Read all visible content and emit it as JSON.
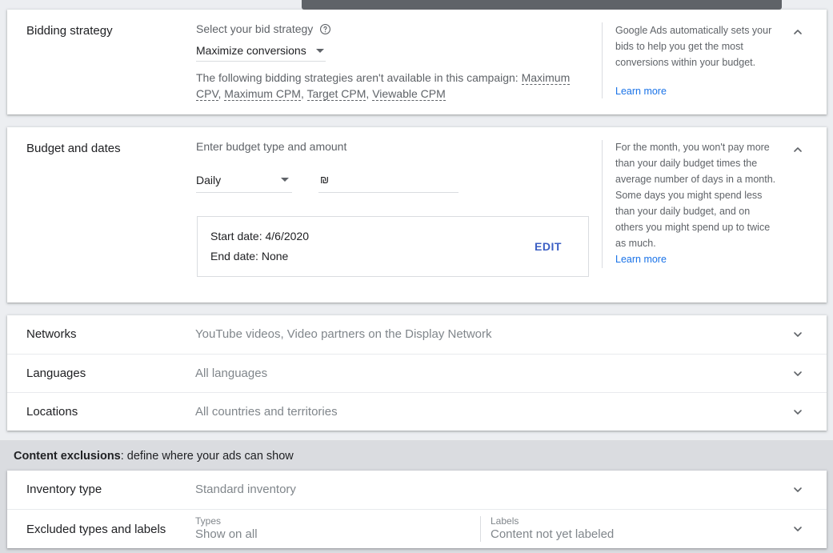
{
  "bidding": {
    "title": "Bidding strategy",
    "select_label": "Select your bid strategy",
    "selected": "Maximize conversions",
    "unavailable_prefix": "The following bidding strategies aren't available in this campaign: ",
    "unavailable": [
      "Maximum CPV",
      "Maximum CPM",
      "Target CPM",
      "Viewable CPM"
    ],
    "help": "Google Ads automatically sets your bids to help you get the most conversions within your budget.",
    "learn_more": "Learn more"
  },
  "budget": {
    "title": "Budget and dates",
    "label": "Enter budget type and amount",
    "type": "Daily",
    "currency_symbol": "₪",
    "start_date": "Start date: 4/6/2020",
    "end_date": "End date: None",
    "edit": "EDIT",
    "help": "For the month, you won't pay more than your daily budget times the average number of days in a month. Some days you might spend less than your daily budget, and on others you might spend up to twice as much.",
    "learn_more": "Learn more"
  },
  "settings_rows": [
    {
      "label": "Networks",
      "value": "YouTube videos, Video partners on the Display Network"
    },
    {
      "label": "Languages",
      "value": "All languages"
    },
    {
      "label": "Locations",
      "value": "All countries and territories"
    }
  ],
  "content_exclusions": {
    "heading_bold": "Content exclusions",
    "heading_rest": ": define where your ads can show",
    "inventory": {
      "label": "Inventory type",
      "value": "Standard inventory"
    },
    "excluded": {
      "label": "Excluded types and labels",
      "types_caption": "Types",
      "types_value": "Show on all",
      "labels_caption": "Labels",
      "labels_value": "Content not yet labeled"
    }
  },
  "icons": {
    "help": "help-circle-icon",
    "expand": "chevron-down-icon",
    "collapse": "chevron-up-icon",
    "dropdown": "caret-down-icon"
  },
  "colors": {
    "link": "#1a73e8",
    "edit": "#3c5fc4",
    "muted": "#5f6368"
  }
}
